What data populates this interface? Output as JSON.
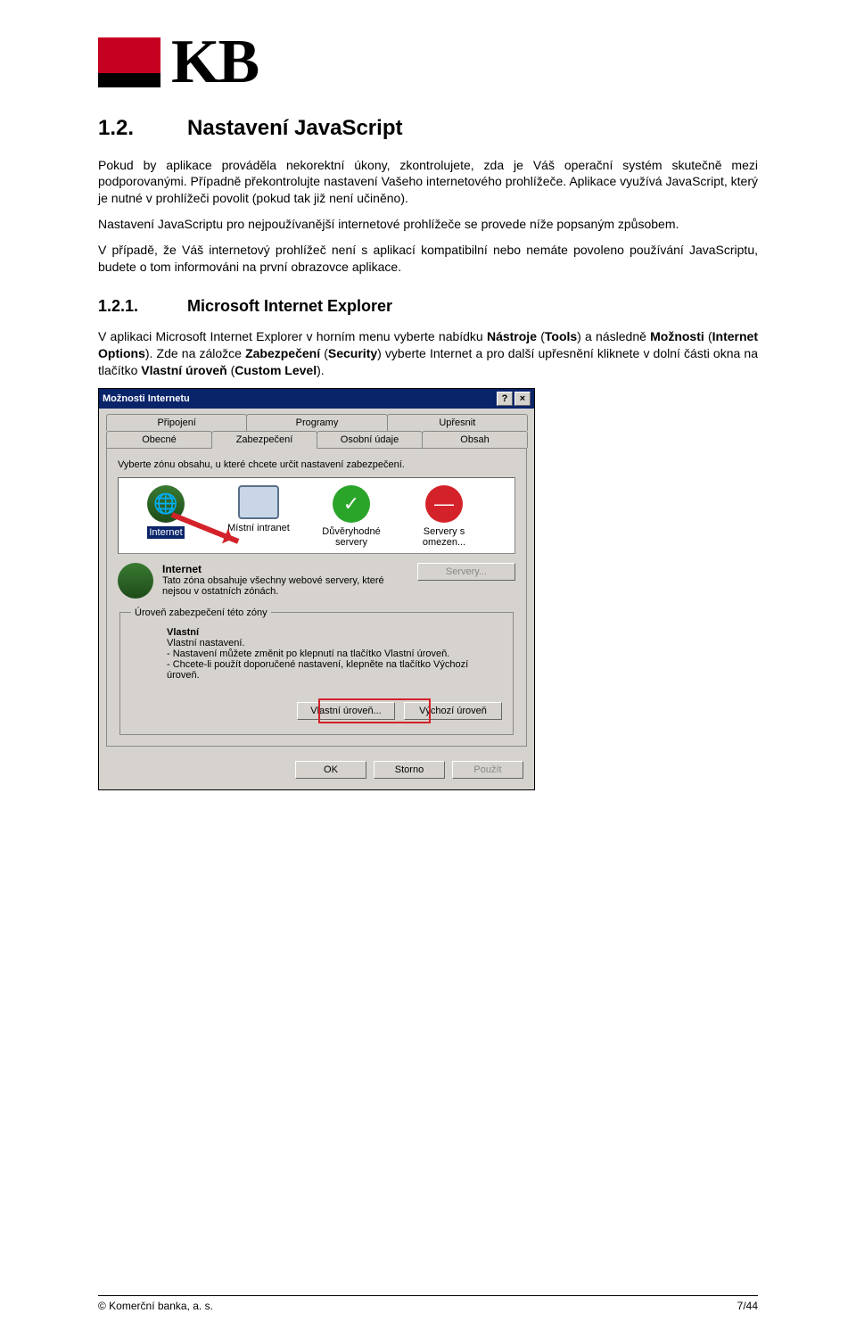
{
  "logo": {
    "text": "KB"
  },
  "section": {
    "num": "1.2.",
    "title": "Nastavení JavaScript"
  },
  "para1": "Pokud by aplikace prováděla nekorektní úkony, zkontrolujete, zda je Váš operační systém skutečně mezi podporovanými. Případně překontrolujte nastavení Vašeho internetového prohlížeče. Aplikace využívá JavaScript, který je nutné v prohlížeči povolit (pokud tak již není učiněno).",
  "para2": "Nastavení JavaScriptu pro nejpoužívanější internetové prohlížeče se provede níže popsaným způsobem.",
  "para3": "V případě, že Váš internetový prohlížeč není s aplikací kompatibilní nebo nemáte povoleno používání JavaScriptu, budete o tom informováni na první obrazovce aplikace.",
  "subsection": {
    "num": "1.2.1.",
    "title": "Microsoft Internet Explorer"
  },
  "sub_p_pre": "V aplikaci Microsoft Internet Explorer v horním menu vyberte nabídku ",
  "sub_b1": "Nástroje",
  "sub_p2": " (",
  "sub_b2": "Tools",
  "sub_p3": ") a následně ",
  "sub_b3": "Možnosti",
  "sub_p4": " (",
  "sub_b4": "Internet Options",
  "sub_p5": "). Zde na záložce ",
  "sub_b5": "Zabezpečení",
  "sub_p6": " (",
  "sub_b6": "Security",
  "sub_p7": ") vyberte Internet a pro další upřesnění kliknete v dolní části okna na tlačítko ",
  "sub_b7": "Vlastní úroveň",
  "sub_p8": " (",
  "sub_b8": "Custom Level",
  "sub_p9": ").",
  "dialog": {
    "title": "Možnosti Internetu",
    "help_btn": "?",
    "close_btn": "×",
    "tabs_row1": [
      "Připojení",
      "Programy",
      "Upřesnit"
    ],
    "tabs_row2": [
      "Obecné",
      "Zabezpečení",
      "Osobní údaje",
      "Obsah"
    ],
    "active_tab": "Zabezpečení",
    "instruction": "Vyberte zónu obsahu, u které chcete určit nastavení zabezpečení.",
    "zones": [
      {
        "label": "Internet",
        "selected": true,
        "icon": "globe"
      },
      {
        "label": "Místní intranet",
        "selected": false,
        "icon": "monitor"
      },
      {
        "label": "Důvěryhodné servery",
        "selected": false,
        "icon": "check"
      },
      {
        "label": "Servery s omezen...",
        "selected": false,
        "icon": "deny"
      }
    ],
    "zone_desc_title": "Internet",
    "zone_desc_text": "Tato zóna obsahuje všechny webové servery, které nejsou v ostatních zónách.",
    "servers_btn": "Servery...",
    "level_legend": "Úroveň zabezpečení této zóny",
    "level_title": "Vlastní",
    "level_line0": "Vlastní nastavení.",
    "level_line1": "- Nastavení můžete změnit po klepnutí na tlačítko Vlastní úroveň.",
    "level_line2": "- Chcete-li použít doporučené nastavení, klepněte na tlačítko Výchozí úroveň.",
    "btn_custom": "Vlastní úroveň...",
    "btn_default": "Výchozí úroveň",
    "btn_ok": "OK",
    "btn_cancel": "Storno",
    "btn_apply": "Použít"
  },
  "footer": {
    "left": "© Komerční banka, a. s.",
    "right": "7/44"
  }
}
